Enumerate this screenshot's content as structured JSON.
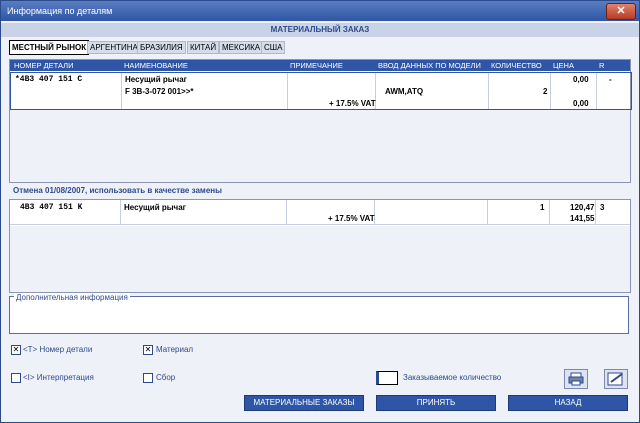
{
  "window": {
    "title": "Информация по деталям",
    "close_symbol": "✕"
  },
  "banner": "МАТЕРИАЛЬНЫЙ ЗАКАЗ",
  "tabs": [
    "МЕСТНЫЙ РЫНОК",
    "АРГЕНТИНА",
    "БРАЗИЛИЯ",
    "КИТАЙ",
    "МЕКСИКА",
    "США"
  ],
  "table": {
    "columns": [
      "НОМЕР ДЕТАЛИ",
      "НАИМЕНОВАНИЕ",
      "ПРИМЕЧАНИЕ",
      "ВВОД ДАННЫХ ПО МОДЕЛИ",
      "КОЛИЧЕСТВО",
      "ЦЕНА",
      "R"
    ],
    "row": {
      "part_number": "*4B3 407 151 C",
      "name": "Несущий рычаг",
      "name_line2": "F 3B-3-072 001>>*",
      "vat": "+ 17.5% VAT",
      "model": "AWM,ATQ",
      "quantity": "2",
      "price": "0,00",
      "price_total": "0,00",
      "r": "-"
    }
  },
  "substitution_notice": "Отмена 01/08/2007, использовать в качестве замены",
  "replacement": {
    "part_number": "4B3 407 151 K",
    "name": "Несущий рычаг",
    "vat": "+ 17.5% VAT",
    "quantity": "1",
    "price": "120,47",
    "price_vat": "141,55",
    "r": "3"
  },
  "additional_info_label": "Дополнительная информация",
  "options": {
    "part_number": {
      "label": "<T> Номер детали",
      "checked": true
    },
    "material": {
      "label": "Материал",
      "checked": true
    },
    "interpretation": {
      "label": "<I> Интерпретация",
      "checked": false
    },
    "assembly": {
      "label": "Сбор",
      "checked": false
    },
    "ordered_qty_label": "Заказываемое количество",
    "check_mark": "✕"
  },
  "buttons": {
    "material_orders": "МАТЕРИАЛЬНЫЕ ЗАКАЗЫ",
    "accept": "ПРИНЯТЬ",
    "back": "НАЗАД"
  }
}
